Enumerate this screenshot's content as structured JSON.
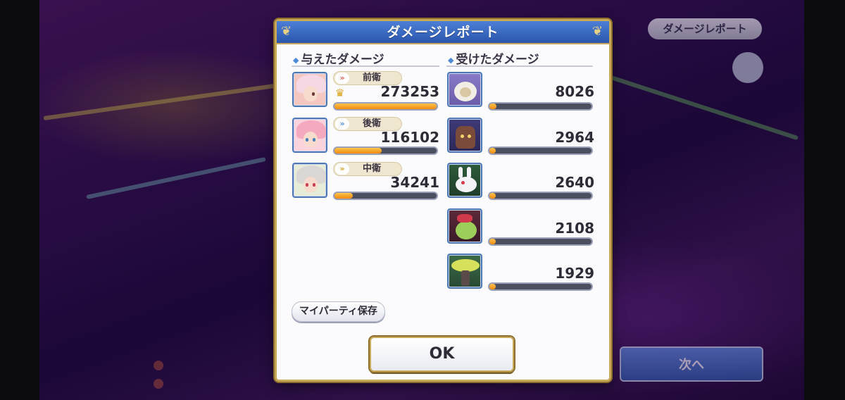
{
  "background": {
    "report_button_label": "ダメージレポート",
    "next_button_label": "次へ",
    "party_icon": "party-icon"
  },
  "dialog": {
    "title": "ダメージレポート",
    "dealt": {
      "title": "与えたダメージ",
      "rows": [
        {
          "role": "前衛",
          "value": "273253",
          "fill_ratio": 1.0,
          "top": true,
          "portrait": "character-portrait-pink-white-hair"
        },
        {
          "role": "後衛",
          "value": "116102",
          "fill_ratio": 0.46,
          "top": false,
          "portrait": "character-portrait-pink-hair"
        },
        {
          "role": "中衛",
          "value": "34241",
          "fill_ratio": 0.18,
          "top": false,
          "portrait": "character-portrait-silver-hair"
        }
      ]
    },
    "taken": {
      "title": "受けたダメージ",
      "rows": [
        {
          "value": "8026",
          "fill_ratio": 0.07,
          "portrait": "sheep-monster-icon"
        },
        {
          "value": "2964",
          "fill_ratio": 0.06,
          "portrait": "tree-stump-monster-icon"
        },
        {
          "value": "2640",
          "fill_ratio": 0.06,
          "portrait": "white-rabbit-monster-icon"
        },
        {
          "value": "2108",
          "fill_ratio": 0.06,
          "portrait": "plant-bulb-monster-icon"
        },
        {
          "value": "1929",
          "fill_ratio": 0.06,
          "portrait": "yellow-tree-monster-icon"
        }
      ]
    },
    "save_party_button": "マイパーティ保存",
    "ok_button": "OK"
  },
  "colors": {
    "header_blue": "#3a6cc4",
    "bar_fill": "#f0a020",
    "frame_gold": "#c9a85a"
  }
}
